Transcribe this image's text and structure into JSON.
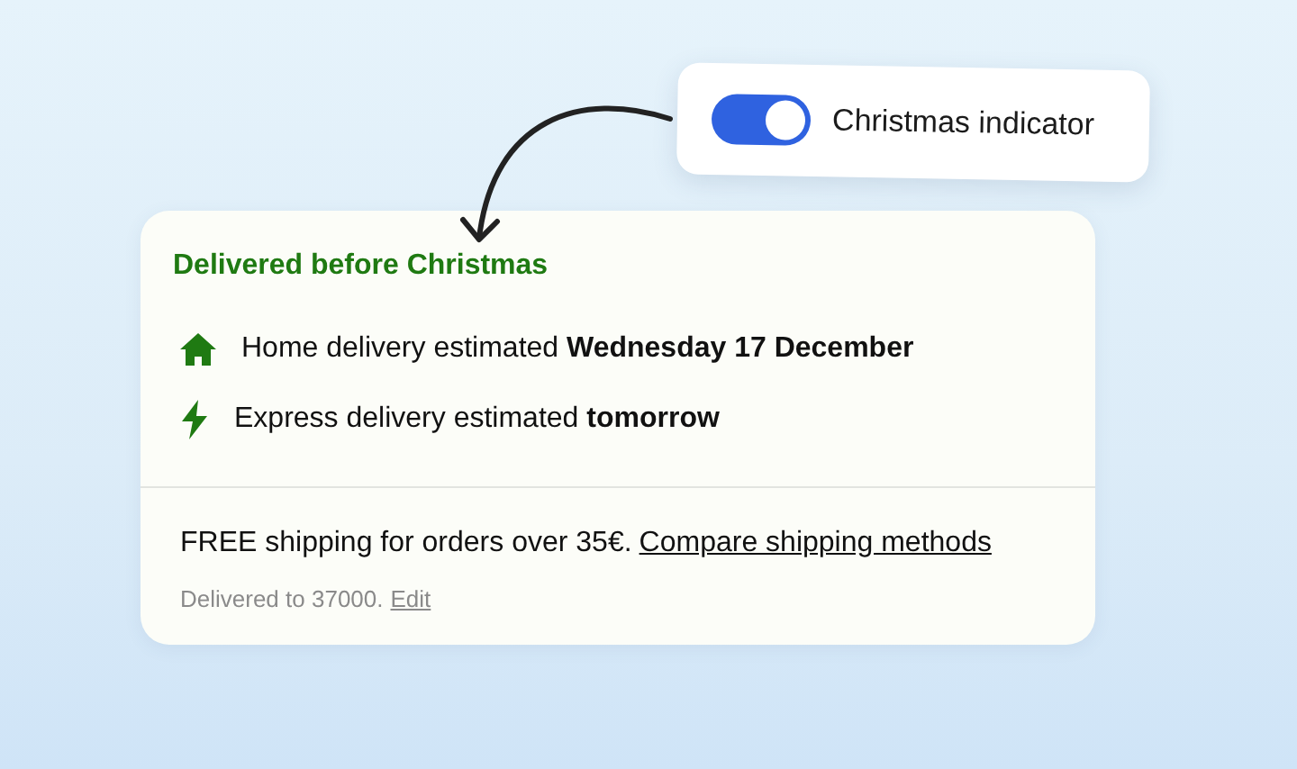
{
  "toggle": {
    "label": "Christmas indicator",
    "on": true
  },
  "delivery": {
    "title": "Delivered before Christmas",
    "options": [
      {
        "kind": "home",
        "text": "Home delivery estimated **Wednesday 17 December**"
      },
      {
        "kind": "express",
        "text": "Express delivery estimated **tomorrow**"
      }
    ]
  },
  "shipping": {
    "text": "FREE shipping for orders over 35€.",
    "link": "Compare shipping methods"
  },
  "address": {
    "text": "Delivered to 37000.",
    "link": "Edit"
  }
}
